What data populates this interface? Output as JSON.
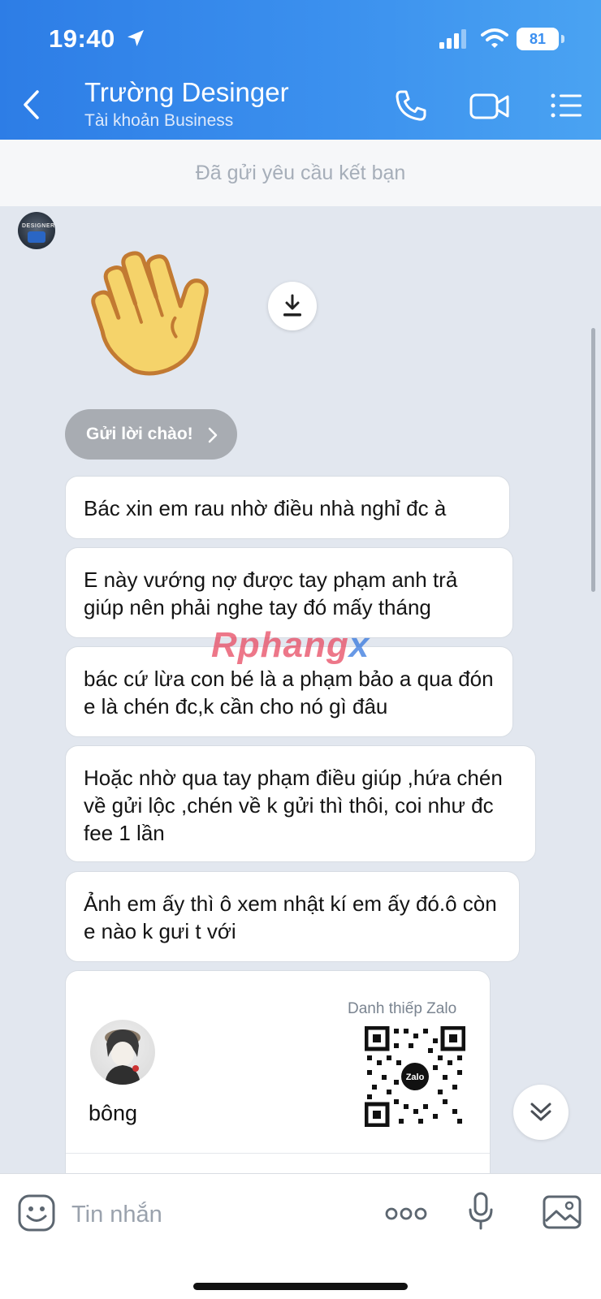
{
  "status_bar": {
    "time": "19:40",
    "battery": "81"
  },
  "header": {
    "contact_name": "Trường Desinger",
    "account_type": "Tài khoản Business"
  },
  "friend_request": {
    "text": "Đã gửi yêu cầu kết bạn"
  },
  "greeting": {
    "label": "Gửi lời chào!"
  },
  "messages": [
    {
      "text": "Bác xin em rau nhờ điều nhà nghỉ  đc à"
    },
    {
      "text": "E này vướng nợ được tay phạm anh trả giúp nên phải nghe tay đó mấy tháng"
    },
    {
      "text": "bác cứ lừa con bé là a phạm bảo a qua đón e là chén đc,k cần cho nó gì đâu"
    },
    {
      "text": "Hoặc nhờ qua tay phạm điều giúp ,hứa chén về gửi lộc ,chén về k gửi thì thôi, coi như đc fee 1 lần"
    },
    {
      "text": "Ảnh em ấy thì ô xem nhật kí em ấy đó.ô còn e nào k gưi t với"
    }
  ],
  "watermark": {
    "part1": "Rphang",
    "part2": "x"
  },
  "contact_card": {
    "label": "Danh thiếp Zalo",
    "name": "bông",
    "qr_logo": "Zalo"
  },
  "composer": {
    "placeholder": "Tin nhắn"
  },
  "colors": {
    "header_start": "#2d7de6",
    "header_end": "#4aa3f2",
    "chat_bg": "#e2e7ef"
  },
  "icons": [
    "location-arrow-icon",
    "signal-icon",
    "wifi-icon",
    "back-icon",
    "phone-icon",
    "video-icon",
    "menu-icon",
    "download-icon",
    "chevron-right-icon",
    "chevrons-down-icon",
    "emoji-icon",
    "more-icon",
    "mic-icon",
    "image-icon"
  ]
}
